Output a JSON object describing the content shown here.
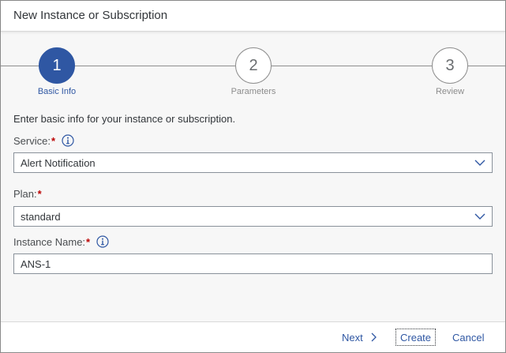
{
  "dialog": {
    "title": "New Instance or Subscription"
  },
  "wizard": {
    "steps": [
      {
        "number": "1",
        "label": "Basic Info",
        "active": true
      },
      {
        "number": "2",
        "label": "Parameters",
        "active": false
      },
      {
        "number": "3",
        "label": "Review",
        "active": false
      }
    ]
  },
  "form": {
    "intro": "Enter basic info for your instance or subscription.",
    "required_marker": "*",
    "service": {
      "label": "Service:",
      "value": "Alert Notification"
    },
    "plan": {
      "label": "Plan:",
      "value": "standard"
    },
    "instance_name": {
      "label": "Instance Name:",
      "value": "ANS-1"
    }
  },
  "footer": {
    "next_label": "Next",
    "create_label": "Create",
    "cancel_label": "Cancel"
  },
  "colors": {
    "accent": "#2f57a3",
    "required": "#bb0000"
  },
  "icons": {
    "info": "info-icon",
    "dropdown": "chevron-down-icon",
    "next": "chevron-right-icon"
  }
}
